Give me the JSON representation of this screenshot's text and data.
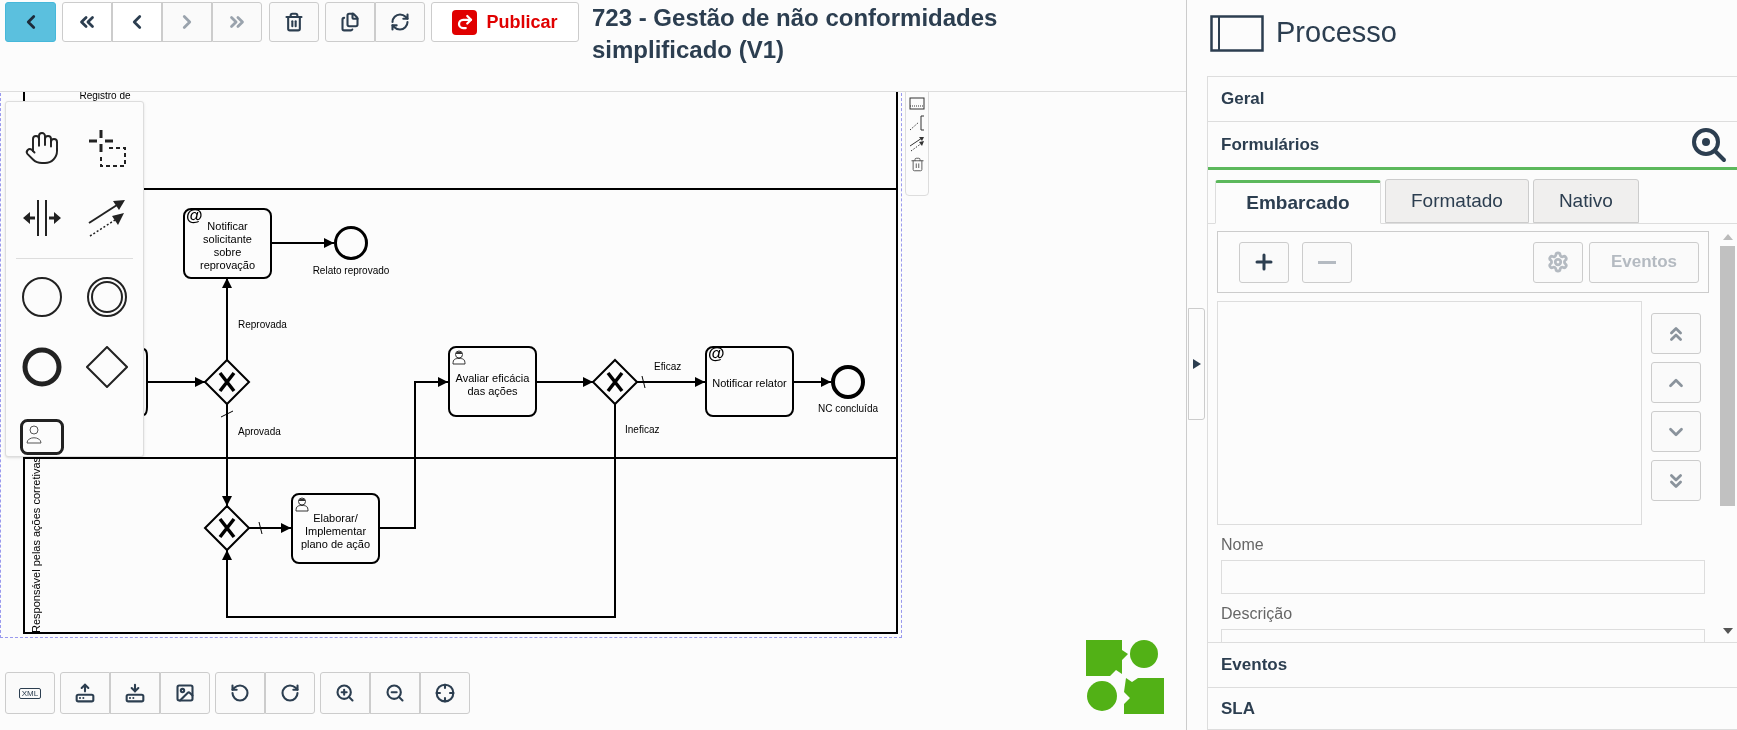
{
  "toolbar": {
    "nav_buttons": [
      {
        "kind": "first",
        "disabled": false
      },
      {
        "kind": "previous",
        "disabled": false
      },
      {
        "kind": "next",
        "disabled": true
      },
      {
        "kind": "last",
        "disabled": true
      }
    ],
    "publish_label": "Publicar"
  },
  "title": "723 - Gestão de não conformidades simplificado (V1)",
  "diagram": {
    "lanes": [
      {
        "label": "Registro de"
      },
      {
        "label": "Responsável pelas ações corretivas"
      }
    ],
    "nodes": [
      {
        "kind": "send_task",
        "marker_text": "@",
        "label": "Notificar solicitante sobre reprovação"
      },
      {
        "kind": "end",
        "label": "Relato reprovado"
      },
      {
        "kind": "user_task",
        "label": "Elaborar/ Implementar plano de ação"
      },
      {
        "kind": "user_task",
        "label": "Avaliar eficácia das ações"
      },
      {
        "kind": "send_task",
        "marker_text": "@",
        "label": "Notificar relator"
      },
      {
        "kind": "end",
        "label": "NC concluída"
      }
    ],
    "flow_labels": [
      "Reprovada",
      "Aprovada",
      "Eficaz",
      "Ineficaz"
    ]
  },
  "bottom_toolbar": {
    "xml_label": "XML"
  },
  "panel": {
    "title": "Processo",
    "sections": [
      {
        "label": "Geral",
        "expanded": false
      },
      {
        "label": "Formulários",
        "expanded": true
      }
    ],
    "tabs": [
      {
        "label": "Embarcado",
        "selected": true
      },
      {
        "label": "Formatado",
        "selected": false
      },
      {
        "label": "Nativo",
        "selected": false
      }
    ],
    "form_buttons": [
      {
        "kind": "add",
        "disabled": false
      },
      {
        "kind": "remove",
        "disabled": true
      },
      {
        "kind": "settings",
        "disabled": true
      },
      {
        "kind": "events",
        "label": "Eventos",
        "disabled": true
      }
    ],
    "fields": [
      {
        "label": "Nome"
      },
      {
        "label": "Descrição"
      }
    ],
    "more_sections": [
      {
        "label": "Eventos",
        "expanded": false
      },
      {
        "label": "SLA",
        "expanded": false
      }
    ]
  }
}
